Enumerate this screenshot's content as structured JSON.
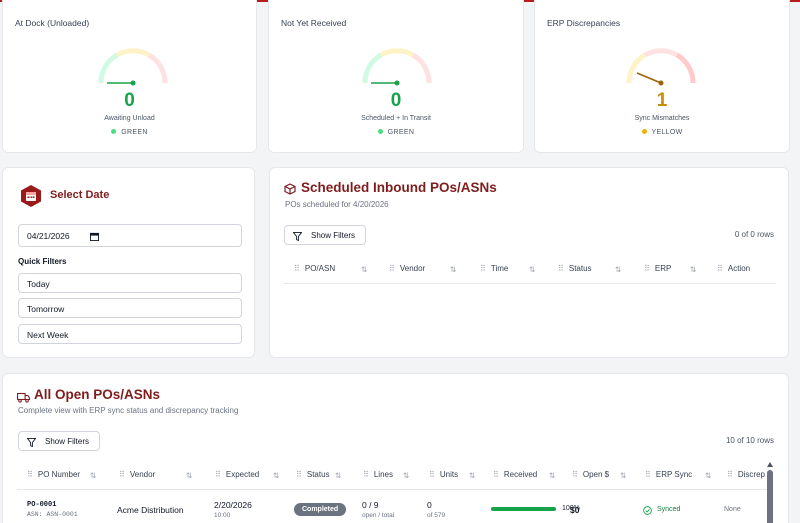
{
  "gauges": [
    {
      "title": "At Dock (Unloaded)",
      "value": "0",
      "subtitle": "Awaiting Unload",
      "status": "GREEN",
      "color": "#4ade80",
      "value_color": "#16a34a",
      "level": 0
    },
    {
      "title": "Not Yet Received",
      "value": "0",
      "subtitle": "Scheduled + In Transit",
      "status": "GREEN",
      "color": "#4ade80",
      "value_color": "#16a34a",
      "level": 0
    },
    {
      "title": "ERP Discrepancies",
      "value": "1",
      "subtitle": "Sync Mismatches",
      "status": "YELLOW",
      "color": "#eab308",
      "value_color": "#ca8a04",
      "level": 0.2
    }
  ],
  "date_panel": {
    "title": "Select Date",
    "date_value": "04/21/2026",
    "quick_filters_label": "Quick Filters",
    "quick_filters": [
      "Today",
      "Tomorrow",
      "Next Week"
    ]
  },
  "scheduled": {
    "title": "Scheduled Inbound POs/ASNs",
    "subtitle": "POs scheduled for 4/20/2026",
    "filter_label": "Show Filters",
    "rows_count": "0 of 0 rows",
    "columns": [
      "PO/ASN",
      "Vendor",
      "Time",
      "Status",
      "ERP",
      "Action"
    ]
  },
  "open_pos": {
    "title": "All Open POs/ASNs",
    "subtitle": "Complete view with ERP sync status and discrepancy tracking",
    "filter_label": "Show Filters",
    "rows_count": "10 of 10 rows",
    "columns": [
      "PO Number",
      "Vendor",
      "Expected",
      "Status",
      "Lines",
      "Units",
      "Received",
      "Open $",
      "ERP Sync",
      "Discrep"
    ],
    "rows": [
      {
        "po": "PO-0001",
        "asn": "ASN: ASN-0001",
        "vendor": "Acme Distribution",
        "expected_date": "2/20/2026",
        "expected_time": "10:00",
        "status": "Completed",
        "lines": "0 / 9",
        "lines_sub": "open / total",
        "units": "0",
        "units_sub": "of 579",
        "received_pct": "100%",
        "received_fraction": 1.0,
        "open_amount": "$0",
        "erp_sync": "Synced",
        "discrep": "None"
      }
    ]
  },
  "colors": {
    "accent": "#7f1d1d",
    "brand_red": "#b91c1c",
    "green": "#16a34a",
    "yellow": "#ca8a04"
  }
}
